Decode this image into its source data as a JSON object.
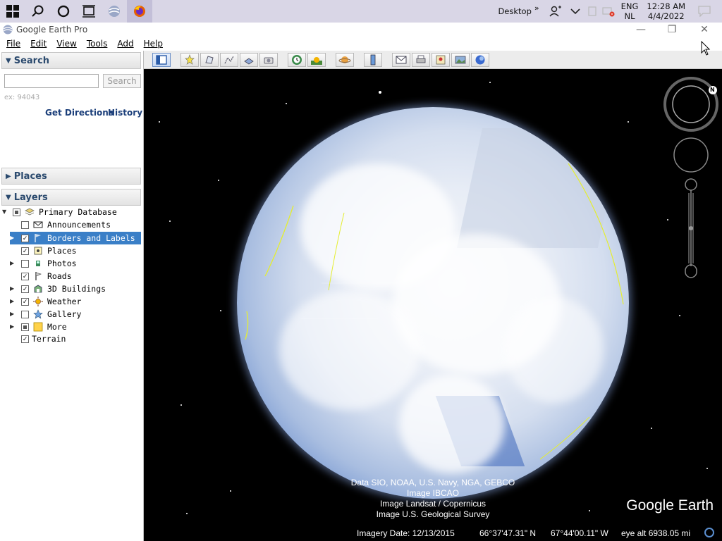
{
  "taskbar": {
    "desktop_label": "Desktop",
    "lang_top": "ENG",
    "lang_bottom": "NL",
    "time": "12:28 AM",
    "date": "4/4/2022",
    "chevron": "»"
  },
  "window": {
    "title": "Google Earth Pro",
    "minimize": "—",
    "restore": "❐",
    "close": "✕"
  },
  "menu": [
    "File",
    "Edit",
    "View",
    "Tools",
    "Add",
    "Help"
  ],
  "search": {
    "header": "Search",
    "placeholder": "",
    "button": "Search",
    "hint": "ex: 94043",
    "get_directions": "Get Directions",
    "history": "History"
  },
  "places": {
    "header": "Places"
  },
  "layers": {
    "header": "Layers",
    "items": [
      {
        "label": "Primary Database",
        "state": "partial"
      },
      {
        "label": "Announcements",
        "state": "unchecked"
      },
      {
        "label": "Borders and Labels",
        "state": "checked"
      },
      {
        "label": "Places",
        "state": "checked"
      },
      {
        "label": "Photos",
        "state": "unchecked"
      },
      {
        "label": "Roads",
        "state": "checked"
      },
      {
        "label": "3D Buildings",
        "state": "checked"
      },
      {
        "label": "Weather",
        "state": "checked"
      },
      {
        "label": "Gallery",
        "state": "unchecked"
      },
      {
        "label": "More",
        "state": "partial"
      },
      {
        "label": "Terrain",
        "state": "checked"
      }
    ]
  },
  "view": {
    "attribution": [
      "Data SIO, NOAA, U.S. Navy, NGA, GEBCO",
      "Image IBCAO",
      "Image Landsat / Copernicus",
      "Image U.S. Geological Survey"
    ],
    "logo": "Google Earth",
    "imagery_date": "Imagery Date: 12/13/2015",
    "lat": "66°37'47.31\" N",
    "lon": "67°44'00.11\" W",
    "eye_alt": "eye alt 6938.05 mi",
    "compass_north": "N"
  },
  "check_mark": "✓"
}
